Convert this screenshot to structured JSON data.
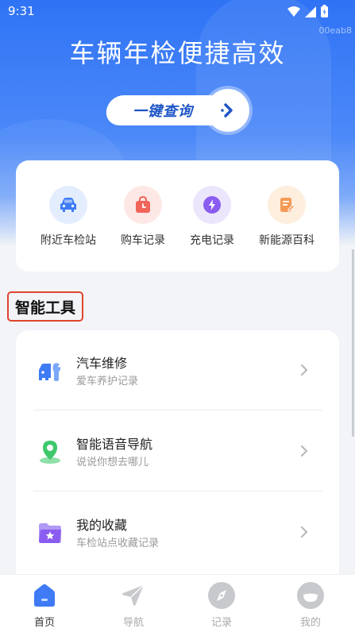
{
  "status_bar": {
    "time": "9:31",
    "device_id": "00eab8"
  },
  "hero": {
    "title": "车辆年检便捷高效",
    "button_label": "一键查询"
  },
  "quick_actions": [
    {
      "label": "附近车检站",
      "icon": "car-icon",
      "color": "#3e7bf5",
      "bg": "#e3edfd"
    },
    {
      "label": "购车记录",
      "icon": "shopping-bag-icon",
      "color": "#f0645a",
      "bg": "#fde8e6"
    },
    {
      "label": "充电记录",
      "icon": "lightning-icon",
      "color": "#8a5cf0",
      "bg": "#ece6fd"
    },
    {
      "label": "新能源百科",
      "icon": "document-edit-icon",
      "color": "#f59a56",
      "bg": "#fdeede"
    }
  ],
  "section": {
    "title": "智能工具"
  },
  "tools": [
    {
      "title": "汽车维修",
      "subtitle": "爱车养护记录",
      "icon": "car-repair-icon",
      "color": "#3e7bf5"
    },
    {
      "title": "智能语音导航",
      "subtitle": "说说你想去哪儿",
      "icon": "map-pin-icon",
      "color": "#3fc86b"
    },
    {
      "title": "我的收藏",
      "subtitle": "车检站点收藏记录",
      "icon": "folder-star-icon",
      "color": "#8a5cf0"
    }
  ],
  "tabbar": {
    "items": [
      {
        "label": "首页",
        "icon": "home-icon",
        "active": true
      },
      {
        "label": "导航",
        "icon": "navigation-icon",
        "active": false
      },
      {
        "label": "记录",
        "icon": "compass-icon",
        "active": false
      },
      {
        "label": "我的",
        "icon": "profile-icon",
        "active": false
      }
    ],
    "active_color": "#3e7bf5",
    "inactive_color": "#c7c9cc"
  }
}
